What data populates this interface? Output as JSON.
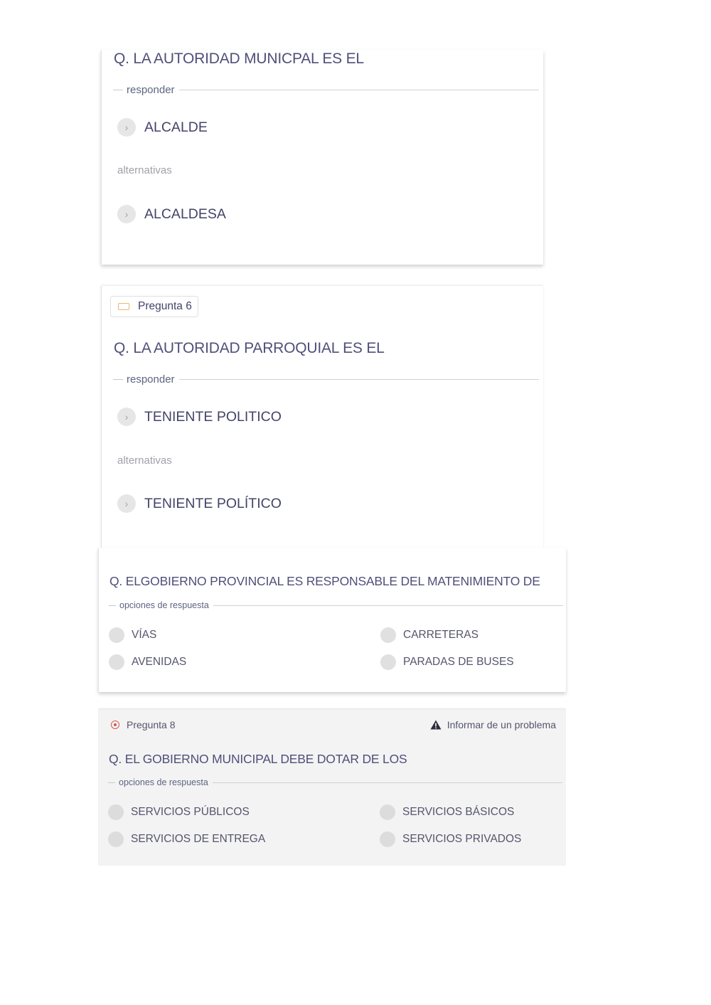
{
  "card1": {
    "question": "Q. LA AUTORIDAD MUNICPAL ES EL",
    "legend": "responder",
    "answer": "ALCALDE",
    "alt_label": "alternativas",
    "alternative": "ALCALDESA"
  },
  "card2": {
    "badge": "Pregunta 6",
    "question": "Q. LA AUTORIDAD PARROQUIAL ES EL",
    "legend": "responder",
    "answer": "TENIENTE POLITICO",
    "alt_label": "alternativas",
    "alternative": "TENIENTE POLÍTICO"
  },
  "card3": {
    "question": "Q. ELGOBIERNO PROVINCIAL ES RESPONSABLE DEL MATENIMIENTO DE",
    "legend": "opciones de respuesta",
    "options": [
      "VÍAS",
      "CARRETERAS",
      "AVENIDAS",
      "PARADAS DE BUSES"
    ]
  },
  "card4": {
    "badge": "Pregunta 8",
    "report": "Informar de un problema",
    "question": "Q. EL GOBIERNO MUNICIPAL DEBE DOTAR DE LOS",
    "legend": "opciones de respuesta",
    "options": [
      "SERVICIOS PÚBLICOS",
      "SERVICIOS BÁSICOS",
      "SERVICIOS DE ENTREGA",
      "SERVICIOS PRIVADOS"
    ]
  }
}
